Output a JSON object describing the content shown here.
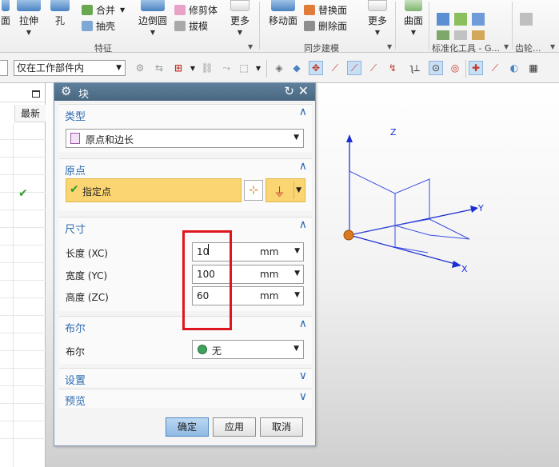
{
  "ribbon": {
    "big_buttons": [
      {
        "label": "面"
      },
      {
        "label": "拉伸"
      },
      {
        "label": "孔"
      },
      {
        "label": "边倒圆"
      },
      {
        "label": "更多"
      },
      {
        "label": "移动面"
      },
      {
        "label": "更多"
      },
      {
        "label": "曲面"
      }
    ],
    "small_buttons": {
      "combine": "合并",
      "shell": "抽壳",
      "trim_body": "修剪体",
      "draft": "拔模",
      "replace_face": "替换面",
      "delete_face": "删除面"
    },
    "groups": {
      "feature": "特征",
      "sync_modeling": "同步建模",
      "std_tools": "标准化工具 - G...",
      "gear": "齿轮..."
    }
  },
  "toolbar": {
    "scope_select": "仅在工作部件内"
  },
  "navigator": {
    "col_newest": "最新"
  },
  "dialog": {
    "title": "块",
    "sections": {
      "type": {
        "label": "类型",
        "value": "原点和边长"
      },
      "origin": {
        "label": "原点",
        "point_label": "指定点"
      },
      "dimensions": {
        "label": "尺寸",
        "rows": [
          {
            "label": "长度 (XC)",
            "value": "10",
            "unit": "mm"
          },
          {
            "label": "宽度 (YC)",
            "value": "100",
            "unit": "mm"
          },
          {
            "label": "高度 (ZC)",
            "value": "60",
            "unit": "mm"
          }
        ]
      },
      "boolean": {
        "label": "布尔",
        "row_label": "布尔",
        "value": "无"
      },
      "settings": {
        "label": "设置"
      },
      "preview": {
        "label": "预览"
      }
    },
    "buttons": {
      "ok": "确定",
      "apply": "应用",
      "cancel": "取消"
    }
  },
  "viewport": {
    "axes": {
      "z": "Z",
      "y": "Y",
      "x": "X"
    }
  },
  "colors": {
    "axis_blue": "#1b2fd0",
    "highlight_red": "#e0161e",
    "accent_blue": "#2d6bb0",
    "selection_yellow": "#fbd571"
  }
}
